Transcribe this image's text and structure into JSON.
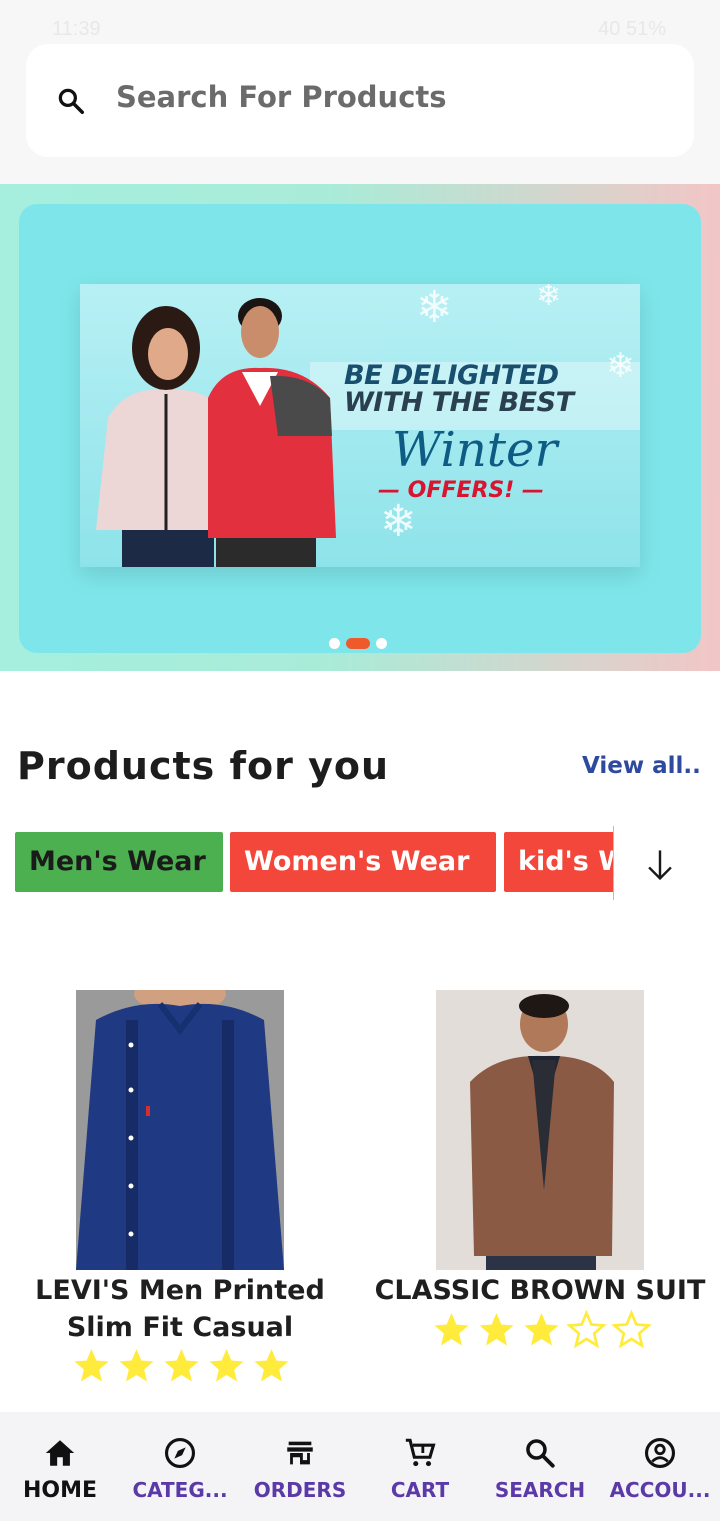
{
  "status_bar": {
    "time": "11:39",
    "system": "40 51%"
  },
  "search": {
    "placeholder": "Search For Products"
  },
  "banner": {
    "headline_line1": "BE DELIGHTED",
    "headline_line2": "WITH THE BEST",
    "script_word": "Winter",
    "offer_text": "— OFFERS! —",
    "carousel_pages": 3,
    "carousel_active_index": 1
  },
  "products_section": {
    "title": "Products for you",
    "view_all": "View all..",
    "categories": [
      "Men's Wear",
      "Women's Wear",
      "kid's Wear"
    ]
  },
  "products": [
    {
      "name": "LEVI'S Men Printed Slim Fit Casual",
      "rating": 5,
      "max_rating": 5
    },
    {
      "name": "CLASSIC BROWN SUIT",
      "rating": 3,
      "max_rating": 5
    }
  ],
  "bottom_nav": {
    "items": [
      {
        "label": "HOME",
        "icon": "home-icon",
        "active": true
      },
      {
        "label": "CATEG...",
        "icon": "compass-icon",
        "active": false
      },
      {
        "label": "ORDERS",
        "icon": "store-icon",
        "active": false
      },
      {
        "label": "CART",
        "icon": "cart-icon",
        "active": false
      },
      {
        "label": "SEARCH",
        "icon": "search-icon",
        "active": false
      },
      {
        "label": "ACCOU...",
        "icon": "account-icon",
        "active": false
      }
    ]
  },
  "colors": {
    "accent_purple": "#5b3aa8",
    "chip_green": "#4caf50",
    "chip_red": "#f2473a",
    "star_yellow": "#ffeb3b",
    "view_all_blue": "#2d4a9e"
  }
}
